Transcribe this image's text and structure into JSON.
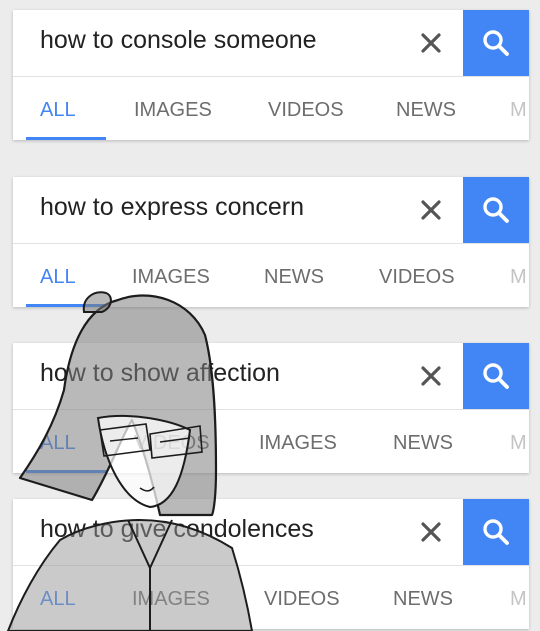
{
  "accent_color": "#4285f4",
  "search_icon": "search-icon",
  "clear_icon": "close-icon",
  "panels": [
    {
      "query": "how to console someone",
      "tabs": [
        "ALL",
        "IMAGES",
        "VIDEOS",
        "NEWS",
        "M"
      ],
      "active_tab": "ALL"
    },
    {
      "query": "how to express concern",
      "tabs": [
        "ALL",
        "IMAGES",
        "NEWS",
        "VIDEOS",
        "M"
      ],
      "active_tab": "ALL"
    },
    {
      "query": "how to show affection",
      "tabs": [
        "ALL",
        "VIDEOS",
        "IMAGES",
        "NEWS",
        "M"
      ],
      "active_tab": "ALL"
    },
    {
      "query": "how to give condolences",
      "tabs": [
        "ALL",
        "IMAGES",
        "VIDEOS",
        "NEWS",
        "M"
      ],
      "active_tab": "ALL"
    }
  ]
}
